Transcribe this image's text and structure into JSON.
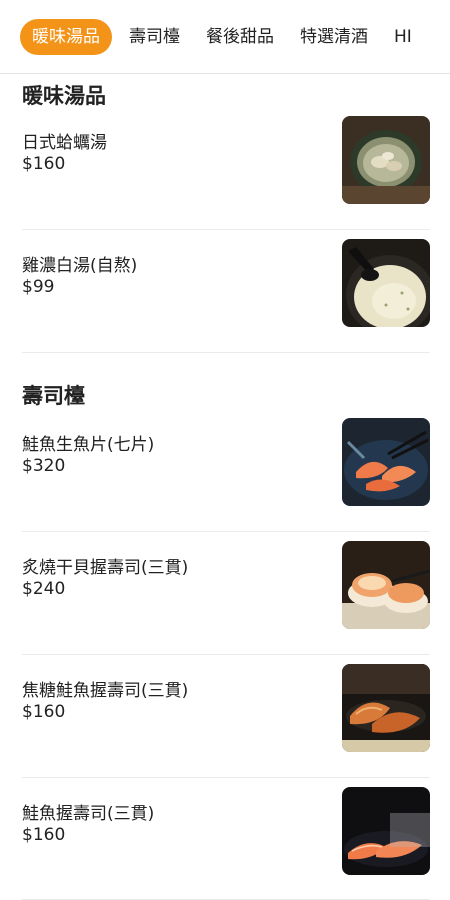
{
  "tabs": [
    {
      "label": "暖味湯品",
      "active": true
    },
    {
      "label": "壽司檯",
      "active": false
    },
    {
      "label": "餐後甜品",
      "active": false
    },
    {
      "label": "特選清酒",
      "active": false
    },
    {
      "label": "HI",
      "active": false
    }
  ],
  "sections": [
    {
      "title": "暖味湯品",
      "items": [
        {
          "name": "日式蛤蠣湯",
          "price": "$160",
          "image": "clam-soup"
        },
        {
          "name": "雞濃白湯(自熬)",
          "price": "$99",
          "image": "chicken-broth"
        }
      ]
    },
    {
      "title": "壽司檯",
      "items": [
        {
          "name": "鮭魚生魚片(七片)",
          "price": "$320",
          "image": "salmon-sashimi"
        },
        {
          "name": "炙燒干貝握壽司(三貫)",
          "price": "$240",
          "image": "scallop-nigiri"
        },
        {
          "name": "焦糖鮭魚握壽司(三貫)",
          "price": "$160",
          "image": "caramel-salmon-nigiri"
        },
        {
          "name": "鮭魚握壽司(三貫)",
          "price": "$160",
          "image": "salmon-nigiri"
        }
      ]
    }
  ],
  "colors": {
    "accent": "#f39317",
    "divider": "#ebebeb"
  }
}
